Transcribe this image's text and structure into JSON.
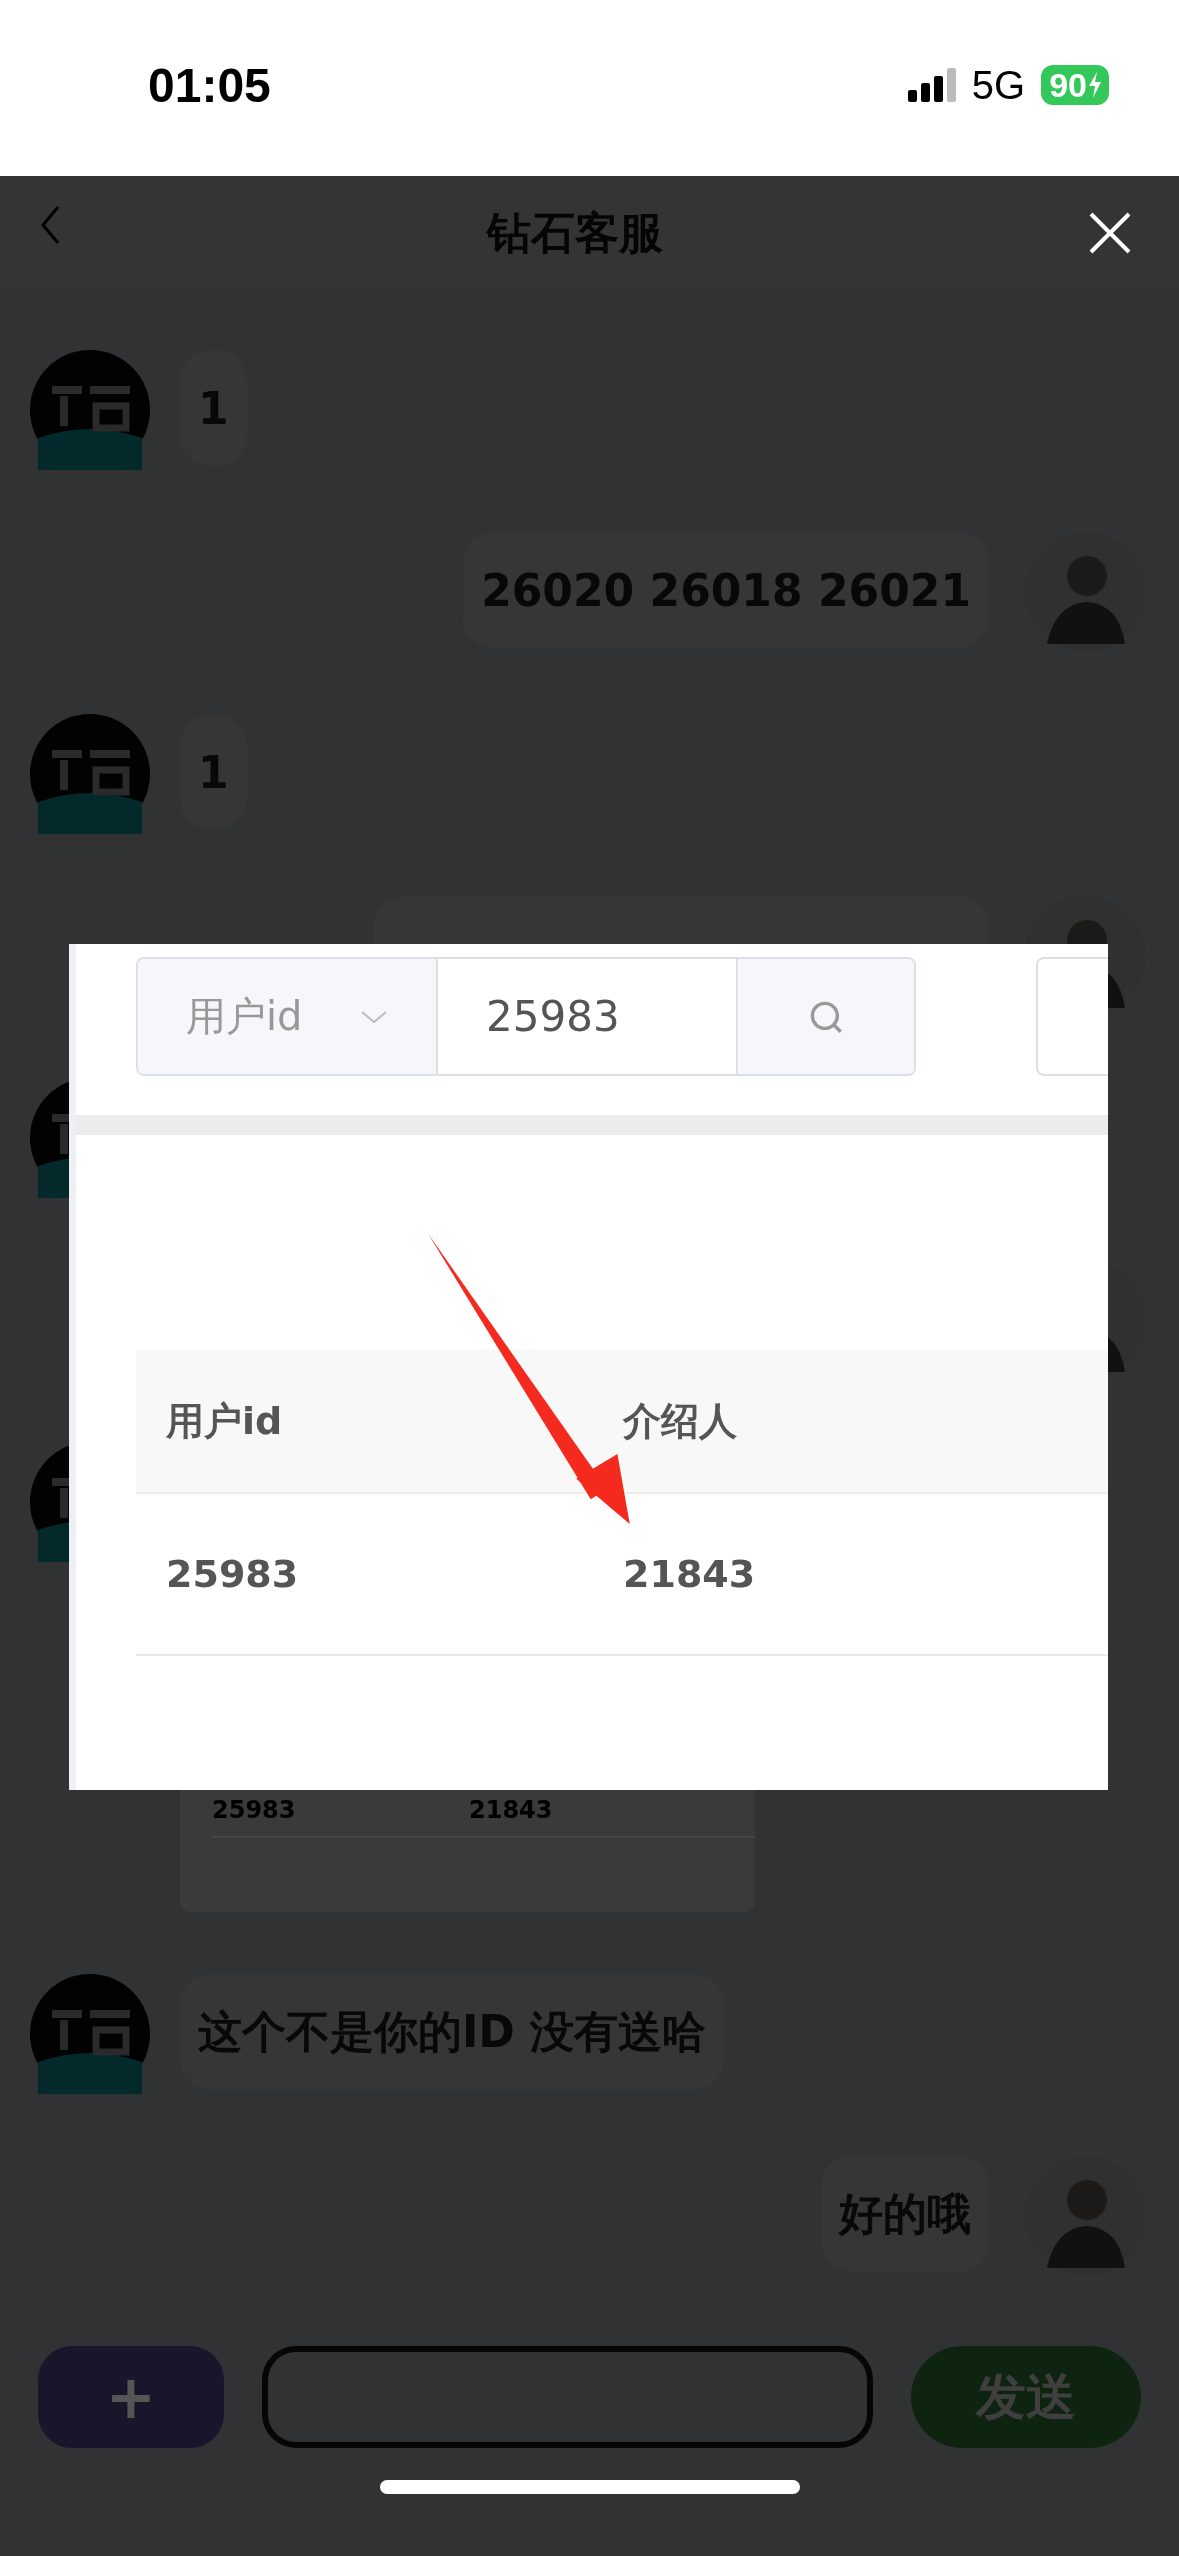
{
  "status_bar": {
    "time": "01:05",
    "network": "5G",
    "battery": "90",
    "charging": true
  },
  "header": {
    "title": "钻石客服"
  },
  "messages": [
    {
      "outgoing": false,
      "kind": "text",
      "text": "1"
    },
    {
      "outgoing": true,
      "kind": "text",
      "text": "26020 26018 26021"
    },
    {
      "outgoing": false,
      "kind": "text",
      "text": "1"
    },
    {
      "outgoing": true,
      "kind": "partial"
    },
    {
      "outgoing": false,
      "kind": "covered"
    },
    {
      "outgoing": true,
      "kind": "covered"
    },
    {
      "outgoing": false,
      "kind": "image",
      "cells": [
        "25983",
        "21843"
      ]
    },
    {
      "outgoing": false,
      "kind": "text",
      "text": "这个不是你的ID 没有送哈"
    },
    {
      "outgoing": true,
      "kind": "text",
      "text": "好的哦"
    }
  ],
  "composer": {
    "add_label": "+",
    "send_label": "发送"
  },
  "image_viewer": {
    "search": {
      "field": "用户id",
      "value": "25983"
    },
    "table": {
      "columns": [
        "用户id",
        "介绍人"
      ],
      "rows": [
        [
          "25983",
          "21843"
        ]
      ]
    }
  }
}
